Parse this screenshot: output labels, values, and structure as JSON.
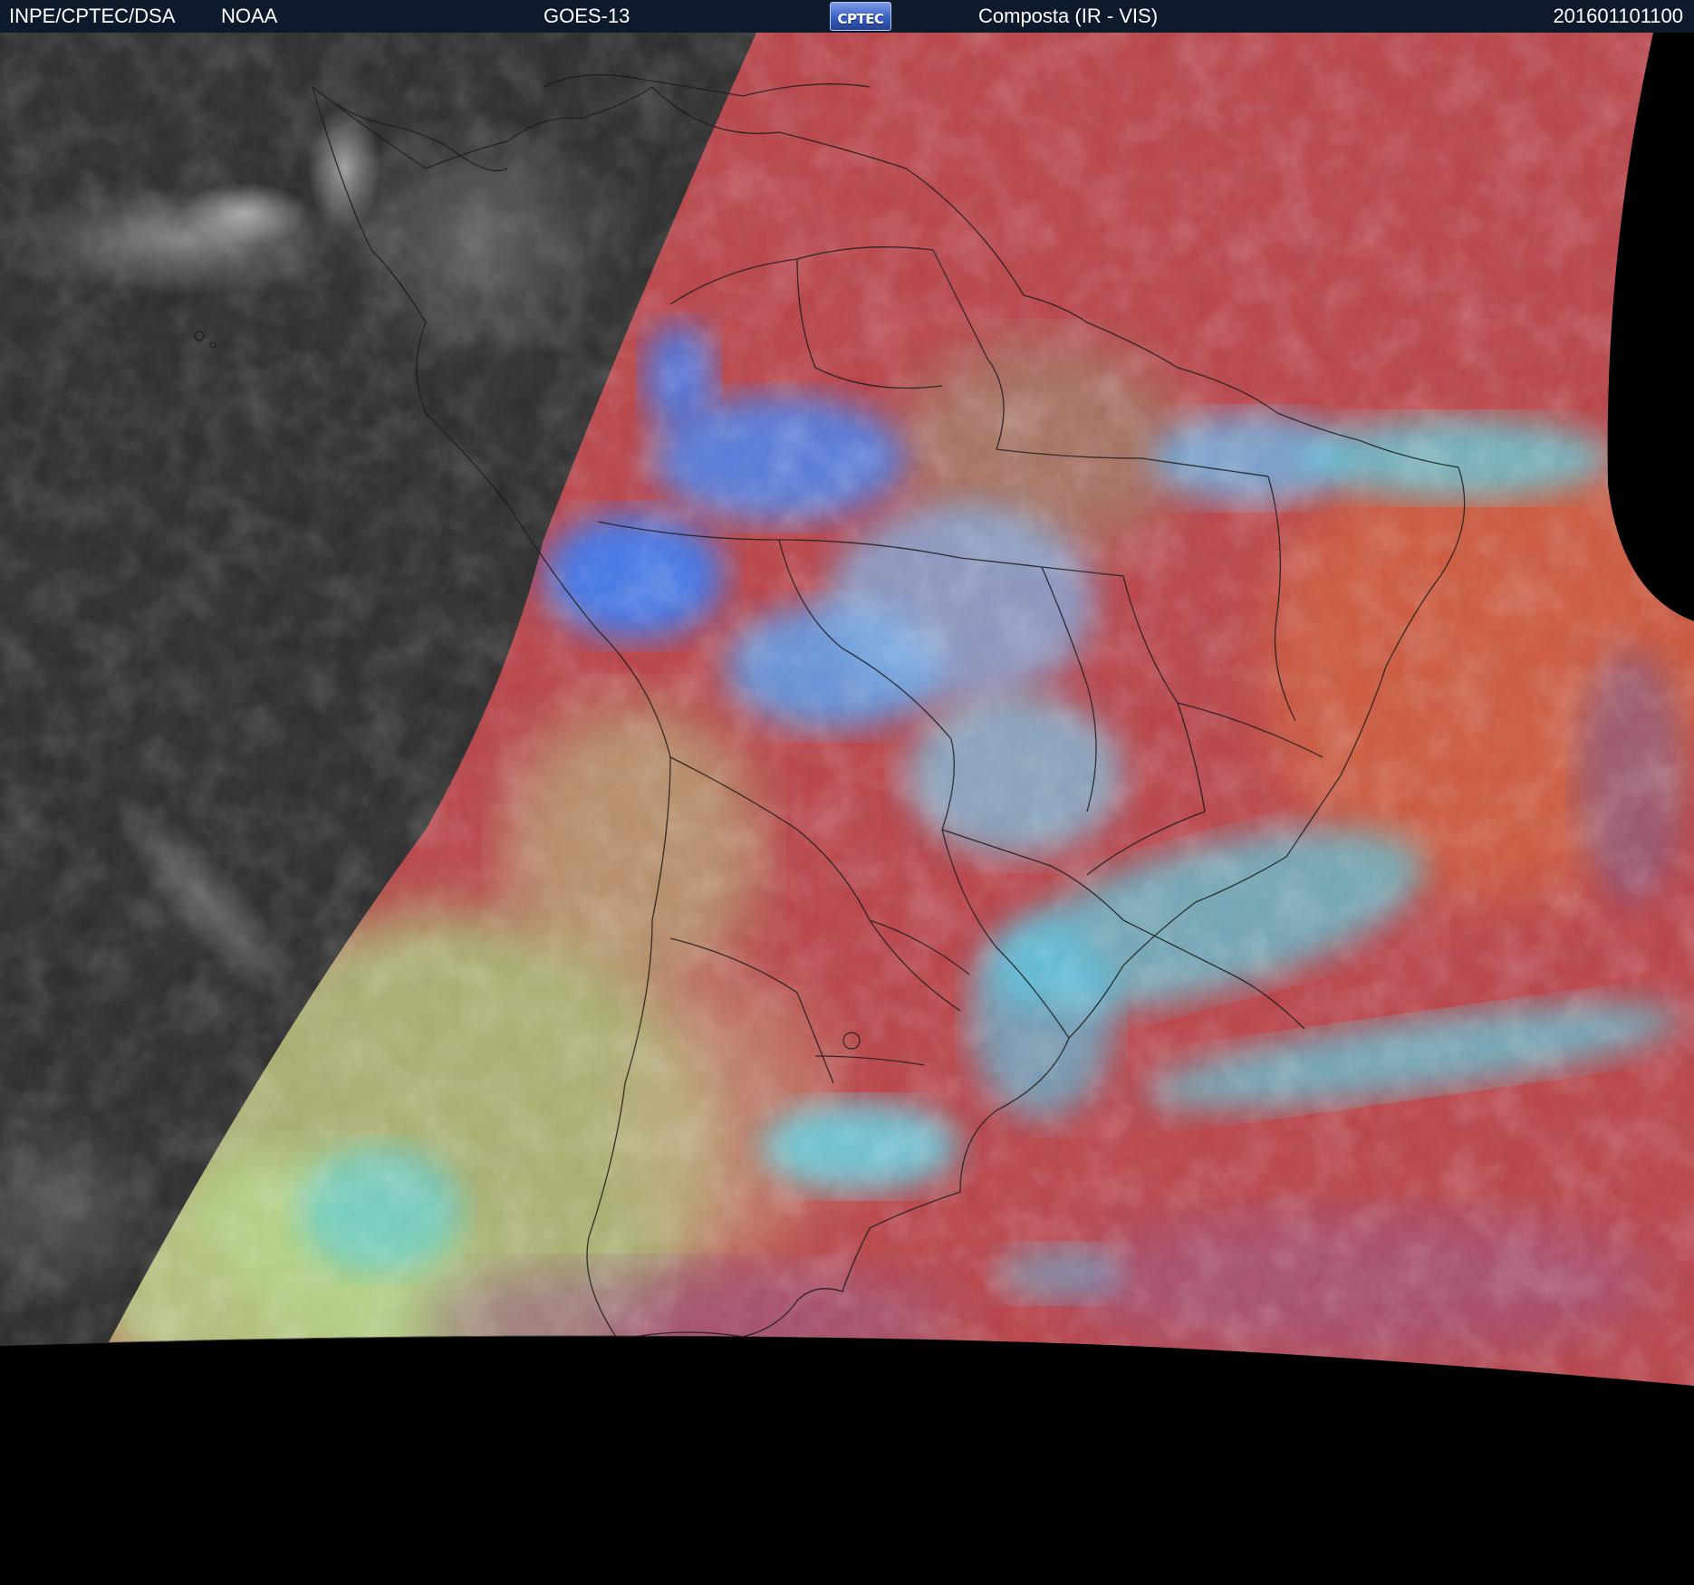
{
  "header": {
    "source": "INPE/CPTEC/DSA",
    "agency": "NOAA",
    "satellite": "GOES-13",
    "logo_text": "CPTEC",
    "product": "Composta (IR - VIS)",
    "timestamp": "201601101100"
  },
  "colors": {
    "header_background": "#0c1a2c",
    "header_text": "#ffffff",
    "night_side_gray": "#2d2d2d",
    "clear_sky_red": "#b9444a",
    "cloud_blue": "#3f7bf0",
    "cloud_cyan": "#5ad2e6",
    "low_cloud_green": "#a9d27a",
    "space_black": "#000000",
    "boundary_lines": "#111111"
  },
  "icons": {
    "logo": "cptec-logo"
  }
}
